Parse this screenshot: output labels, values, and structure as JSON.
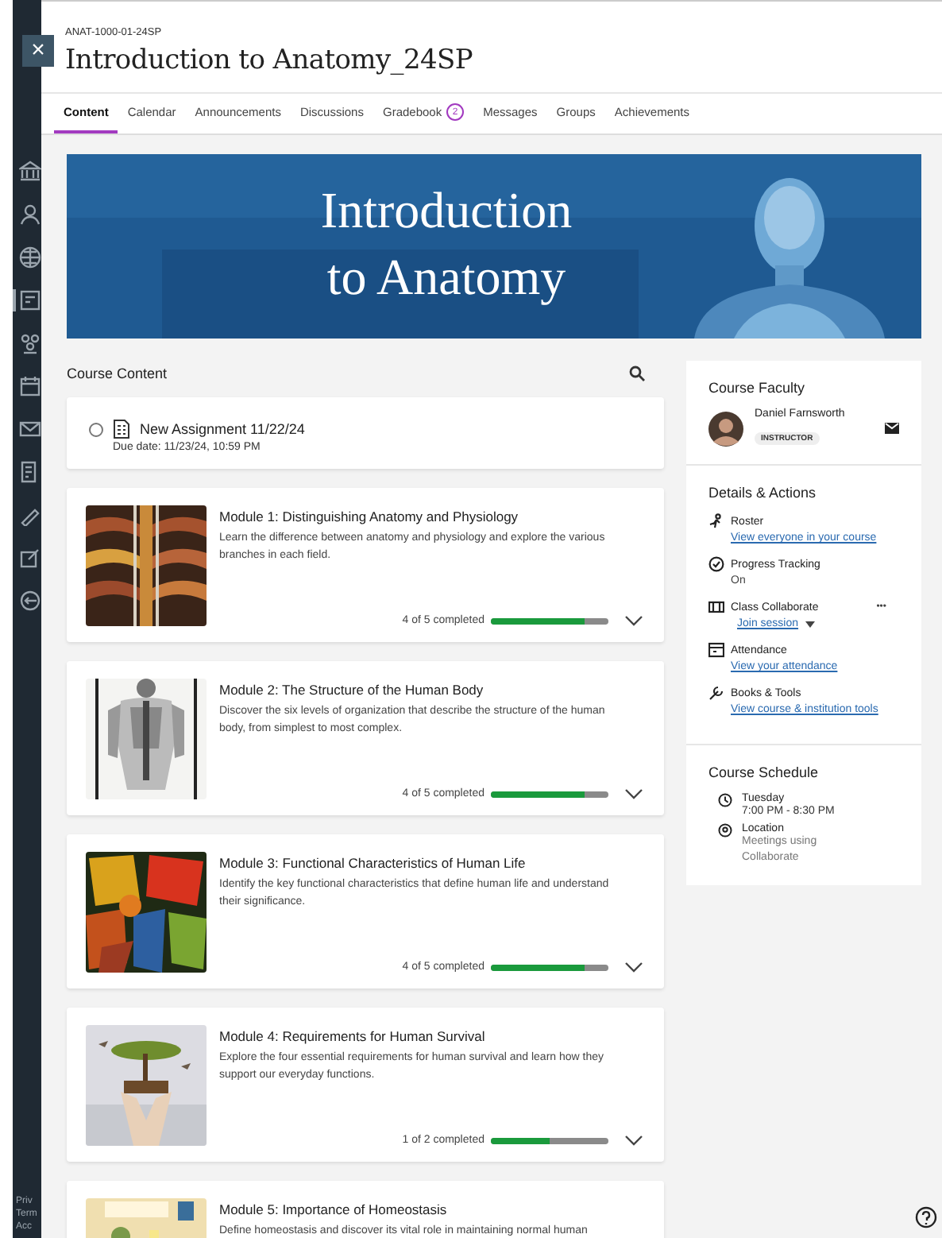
{
  "nav_footer": [
    "Priv",
    "Term",
    "Acc"
  ],
  "course": {
    "close": "×",
    "code": "ANAT-1000-01-24SP",
    "title": "Introduction to Anatomy_24SP"
  },
  "tabs": [
    {
      "label": "Content",
      "selected": true
    },
    {
      "label": "Calendar",
      "selected": false
    },
    {
      "label": "Announcements",
      "selected": false
    },
    {
      "label": "Discussions",
      "selected": false
    },
    {
      "label": "Gradebook",
      "selected": false,
      "badge": "2"
    },
    {
      "label": "Messages",
      "selected": false
    },
    {
      "label": "Groups",
      "selected": false
    },
    {
      "label": "Achievements",
      "selected": false
    }
  ],
  "banner": {
    "lines": [
      "Introduction",
      "to Anatomy"
    ]
  },
  "course_content": {
    "heading": "Course Content",
    "assignment": {
      "title": "New Assignment 11/22/24",
      "due": "Due date: 11/23/24, 10:59 PM",
      "checked": false
    },
    "modules": [
      {
        "title": "Module 1: Distinguishing Anatomy and Physiology",
        "description": "Learn the difference between anatomy and physiology and explore the various branches in each field.",
        "progress": "4 of 5 completed",
        "level": 0.8
      },
      {
        "title": "Module 2: The Structure of the Human Body",
        "description": "Discover the six levels of organization that describe the structure of the human body, from simplest to most complex.",
        "progress": "4 of 5 completed",
        "level": 0.8
      },
      {
        "title": "Module 3: Functional Characteristics of Human Life",
        "description": "Identify the key functional characteristics that define human life and understand their significance.",
        "progress": "4 of 5 completed",
        "level": 0.8
      },
      {
        "title": "Module 4: Requirements for Human Survival",
        "description": "Explore the four essential requirements for human survival and learn how they support our everyday functions.",
        "progress": "1 of 2 completed",
        "level": 0.5
      },
      {
        "title": "Module 5: Importance of Homeostasis",
        "description": "Define homeostasis and discover its vital role in maintaining normal human"
      }
    ]
  },
  "faculty": {
    "heading": "Course Faculty",
    "name": "Daniel Farnsworth",
    "role": "INSTRUCTOR"
  },
  "details": {
    "heading": "Details & Actions",
    "items": [
      {
        "kind": "roster",
        "label": "Roster",
        "link": "View everyone in your course"
      },
      {
        "kind": "progress",
        "label": "Progress Tracking",
        "value": "On"
      },
      {
        "kind": "collaborate",
        "label": "Class Collaborate",
        "link": "Join session",
        "more": "•••"
      },
      {
        "kind": "attendance",
        "label": "Attendance",
        "link": "View your attendance"
      },
      {
        "kind": "tools",
        "label": "Books & Tools",
        "link": "View course & institution tools"
      }
    ]
  },
  "schedule": {
    "heading": "Course Schedule",
    "items": [
      {
        "kind": "time",
        "label": "Tuesday",
        "value": "7:00 PM - 8:30 PM"
      },
      {
        "kind": "location",
        "label": "Location",
        "value": "Meetings using Collaborate"
      }
    ]
  }
}
